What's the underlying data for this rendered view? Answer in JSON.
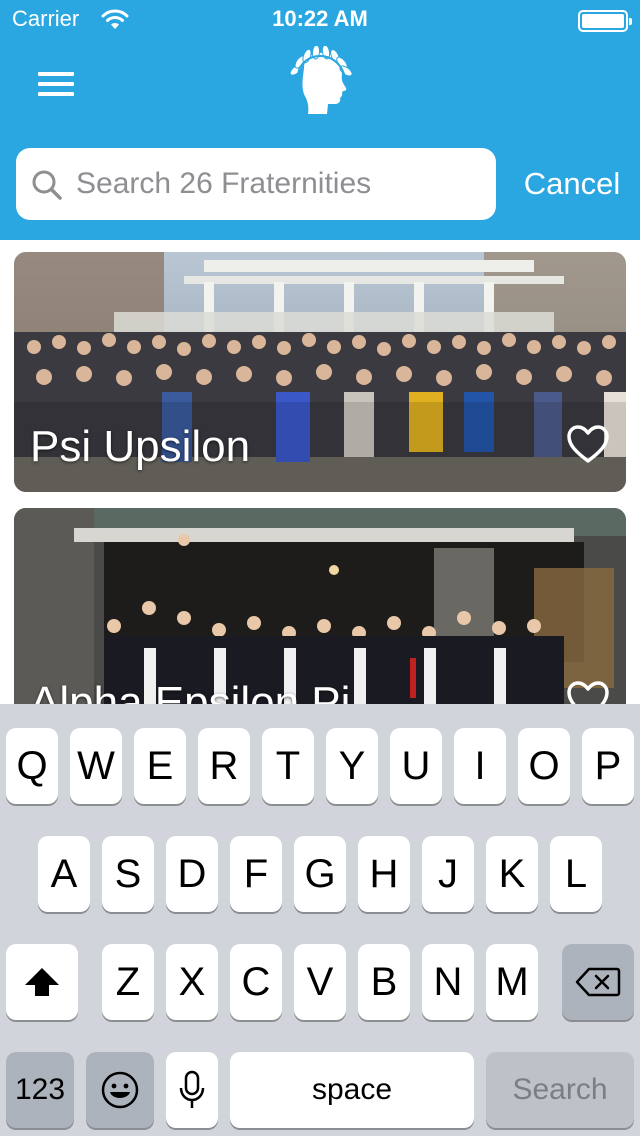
{
  "status_bar": {
    "carrier": "Carrier",
    "time": "10:22 AM"
  },
  "search": {
    "placeholder": "Search 26 Fraternities",
    "value": "",
    "cancel_label": "Cancel"
  },
  "fraternities": [
    {
      "name": "Psi Upsilon",
      "favorited": false
    },
    {
      "name": "Alpha Epsilon Pi",
      "favorited": false
    }
  ],
  "keyboard": {
    "row1": [
      "Q",
      "W",
      "E",
      "R",
      "T",
      "Y",
      "U",
      "I",
      "O",
      "P"
    ],
    "row2": [
      "A",
      "S",
      "D",
      "F",
      "G",
      "H",
      "J",
      "K",
      "L"
    ],
    "row3": [
      "Z",
      "X",
      "C",
      "V",
      "B",
      "N",
      "M"
    ],
    "numbers_label": "123",
    "space_label": "space",
    "search_label": "Search"
  },
  "colors": {
    "header": "#2aa7e1",
    "keyboard_bg": "#d1d4da"
  }
}
